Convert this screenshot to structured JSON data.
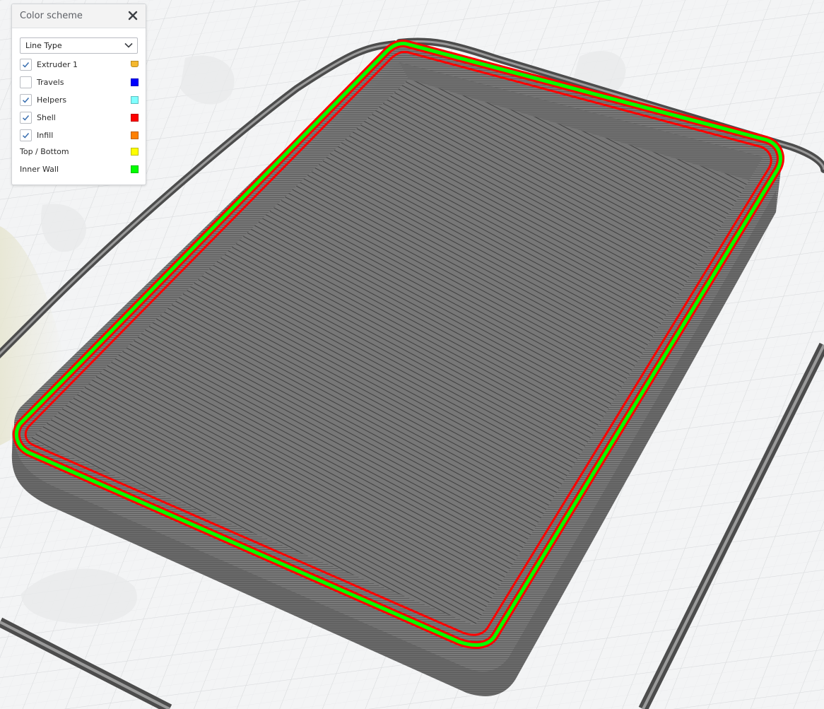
{
  "color_scheme": {
    "title": "Color scheme",
    "close_icon": "close-icon",
    "view_mode": "Line Type",
    "items": [
      {
        "label": "Extruder 1",
        "checkbox": true,
        "checked": true,
        "color": "#f5b82e"
      },
      {
        "label": "Travels",
        "checkbox": true,
        "checked": false,
        "color": "#0000ff"
      },
      {
        "label": "Helpers",
        "checkbox": true,
        "checked": true,
        "color": "#80ffff"
      },
      {
        "label": "Shell",
        "checkbox": true,
        "checked": true,
        "color": "#ff0000"
      },
      {
        "label": "Infill",
        "checkbox": true,
        "checked": true,
        "color": "#ff8000"
      },
      {
        "label": "Top / Bottom",
        "checkbox": false,
        "color": "#ffff00"
      },
      {
        "label": "Inner Wall",
        "checkbox": false,
        "color": "#00ff00"
      }
    ]
  },
  "colors": {
    "background": "#f3f4f5",
    "grid": "#d4d6d8",
    "layer_gray": "#6e6e6e",
    "shell": "#ff0000",
    "inner_wall": "#00ff00"
  }
}
